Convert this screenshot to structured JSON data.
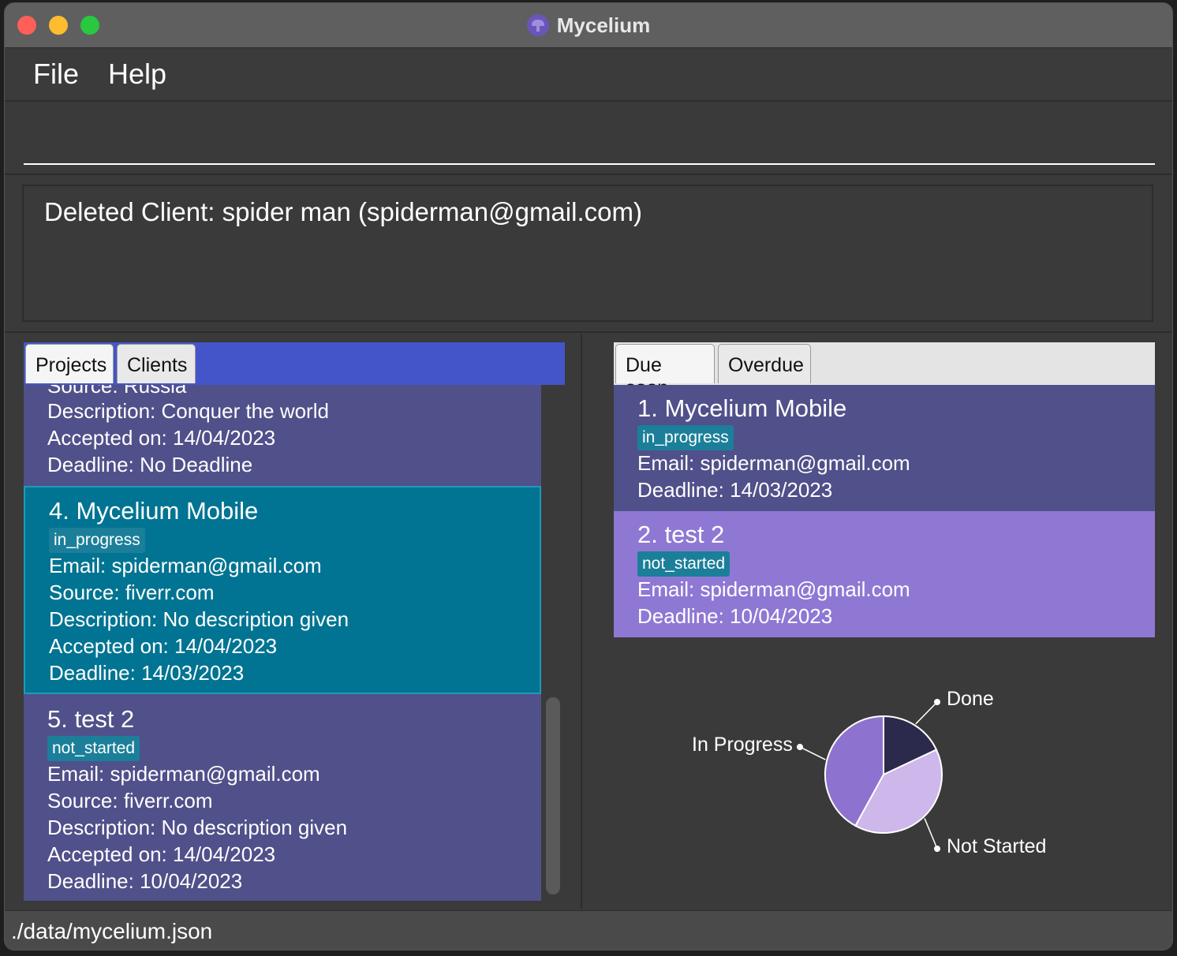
{
  "window": {
    "title": "Mycelium"
  },
  "menu": {
    "file": "File",
    "help": "Help"
  },
  "command": {
    "value": "",
    "placeholder": ""
  },
  "result": {
    "text": "Deleted Client: spider man (spiderman@gmail.com)"
  },
  "left_tabs": {
    "projects": "Projects",
    "clients": "Clients"
  },
  "projects": {
    "partial": {
      "source_cut": "Source: Russia",
      "description": "Description: Conquer the world",
      "accepted": "Accepted on: 14/04/2023",
      "deadline": "Deadline: No Deadline"
    },
    "items": [
      {
        "heading": "4.  Mycelium Mobile",
        "status": "in_progress",
        "email": "Email: spiderman@gmail.com",
        "source": "Source: fiverr.com",
        "description": "Description: No description given",
        "accepted": "Accepted on: 14/04/2023",
        "deadline": "Deadline: 14/03/2023"
      },
      {
        "heading": "5.  test 2",
        "status": "not_started",
        "email": "Email: spiderman@gmail.com",
        "source": "Source: fiverr.com",
        "description": "Description: No description given",
        "accepted": "Accepted on: 14/04/2023",
        "deadline": "Deadline: 10/04/2023"
      }
    ]
  },
  "right_tabs": {
    "due_soon": "Due soon",
    "overdue": "Overdue"
  },
  "due": {
    "items": [
      {
        "heading": "1.  Mycelium Mobile",
        "status": "in_progress",
        "email": "Email: spiderman@gmail.com",
        "deadline": "Deadline: 14/03/2023"
      },
      {
        "heading": "2.  test 2",
        "status": "not_started",
        "email": "Email: spiderman@gmail.com",
        "deadline": "Deadline: 10/04/2023"
      }
    ]
  },
  "chart_data": {
    "type": "pie",
    "labels": [
      "Done",
      "Not Started",
      "In Progress"
    ],
    "values": [
      18,
      40,
      42
    ],
    "colors": [
      "#2b2a4c",
      "#cdb7eb",
      "#8d73cf"
    ]
  },
  "status_bar": {
    "path": "./data/mycelium.json"
  },
  "colors": {
    "card_default": "#50508a",
    "card_selected": "#007492",
    "card_purple": "#8f78d4",
    "badge": "#1b7f9a",
    "tab_bar_left": "#4455c9"
  }
}
